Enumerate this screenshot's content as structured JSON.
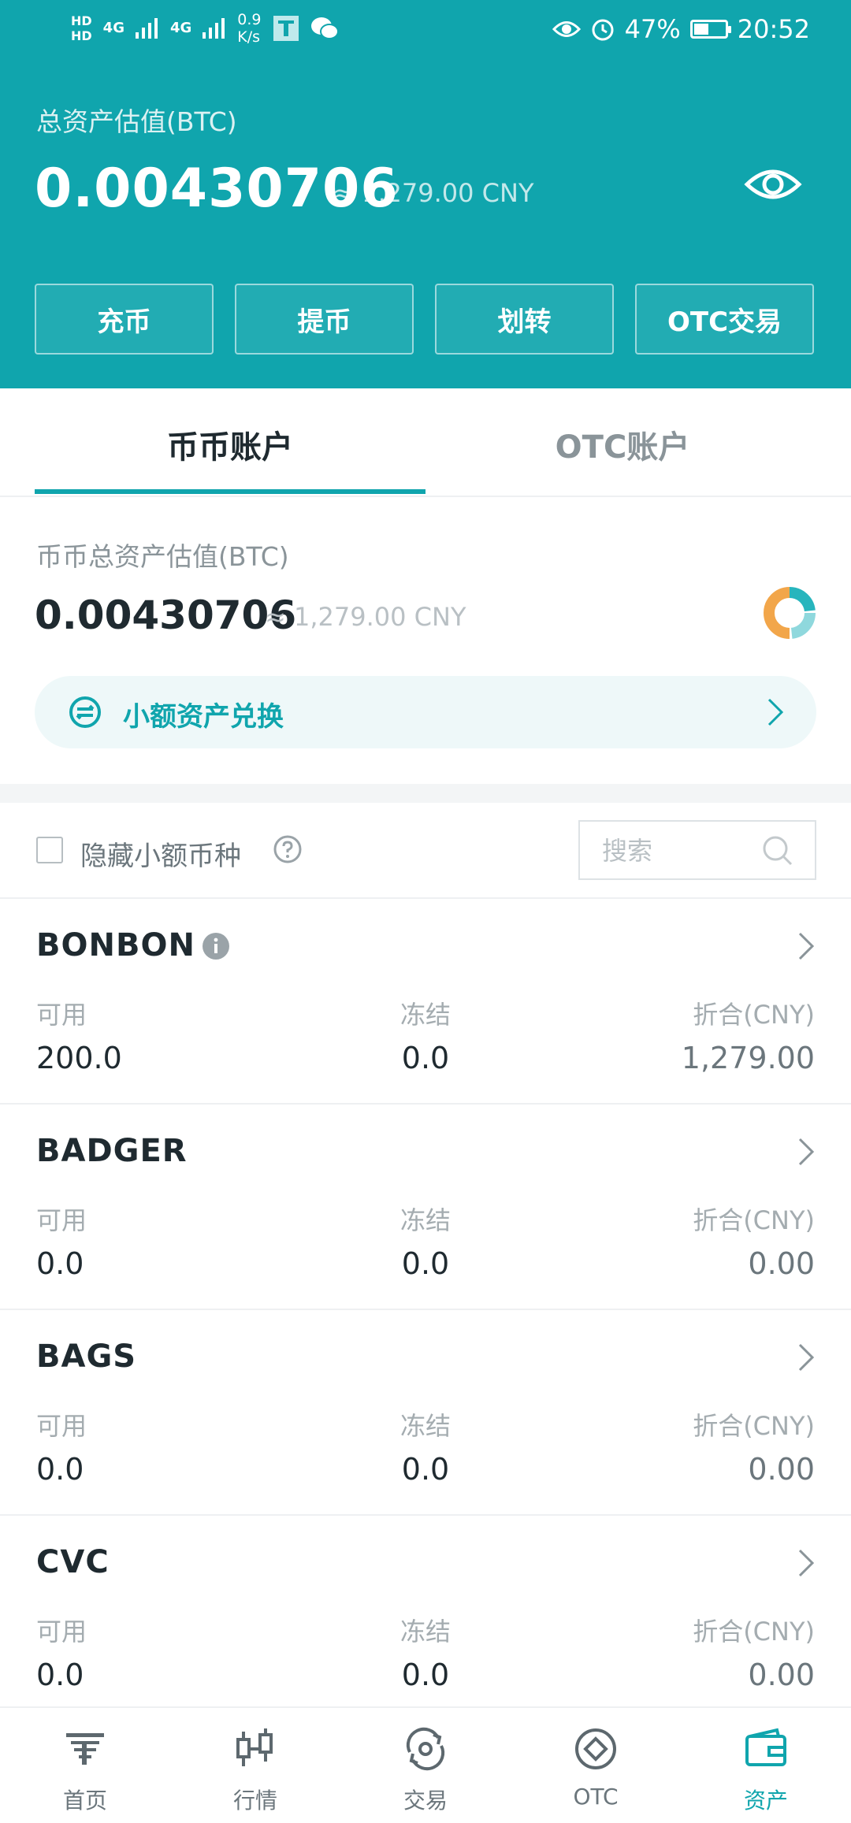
{
  "status_bar": {
    "hd1": "HD",
    "hd2": "HD",
    "net1": "4G",
    "net2": "4G",
    "speed_value": "0.9",
    "speed_unit": "K/s",
    "battery_text": "47%",
    "battery_level": 0.47,
    "time": "20:52"
  },
  "header": {
    "total_label": "总资产估值(BTC)",
    "total_amount": "0.00430706",
    "total_approx": "≈ 1,279.00 CNY",
    "actions": [
      "充币",
      "提币",
      "划转",
      "OTC交易"
    ]
  },
  "tabs": [
    "币币账户",
    "OTC账户"
  ],
  "account": {
    "label": "币币总资产估值(BTC)",
    "amount": "0.00430706",
    "approx": "≈ 1,279.00 CNY"
  },
  "exchange_banner": {
    "label": "小额资产兑换"
  },
  "filter": {
    "hide_small_label": "隐藏小额币种",
    "search_placeholder": "搜索"
  },
  "columns": {
    "available": "可用",
    "frozen": "冻结",
    "cny": "折合(CNY)"
  },
  "assets": [
    {
      "name": "BONBON",
      "available": "200.0",
      "frozen": "0.0",
      "cny": "1,279.00"
    },
    {
      "name": "BADGER",
      "available": "0.0",
      "frozen": "0.0",
      "cny": "0.00"
    },
    {
      "name": "BAGS",
      "available": "0.0",
      "frozen": "0.0",
      "cny": "0.00"
    },
    {
      "name": "CVC",
      "available": "0.0",
      "frozen": "0.0",
      "cny": "0.00"
    }
  ],
  "bottom_nav": [
    "首页",
    "行情",
    "交易",
    "OTC",
    "资产"
  ],
  "colors": {
    "accent": "#10a5ad",
    "donut_orange": "#f2a64a",
    "donut_teal": "#27b5bd",
    "donut_light": "#8fd8dd"
  }
}
